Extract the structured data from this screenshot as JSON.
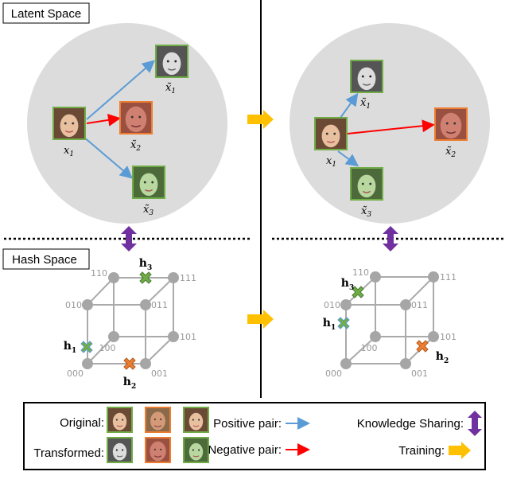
{
  "panels": {
    "latent_space": "Latent Space",
    "hash_space": "Hash Space"
  },
  "variables": {
    "x": "x",
    "x_tilde": "x̃",
    "h": "h",
    "sub1": "1",
    "sub2": "2",
    "sub3": "3"
  },
  "bits": [
    "000",
    "001",
    "010",
    "011",
    "100",
    "101",
    "110",
    "111"
  ],
  "legend": {
    "original": "Original:",
    "transformed": "Transformed:",
    "positive_pair": "Positive pair:",
    "negative_pair": "Negative pair:",
    "knowledge_sharing": "Knowledge Sharing:",
    "training": "Training:"
  },
  "colors": {
    "positive": "#5b9bd5",
    "negative": "#ff0000",
    "knowledge": "#7030a0",
    "training": "#ffc000",
    "same_identity": "#70ad47",
    "other_identity": "#ed7d31",
    "node": "#a6a6a6"
  }
}
